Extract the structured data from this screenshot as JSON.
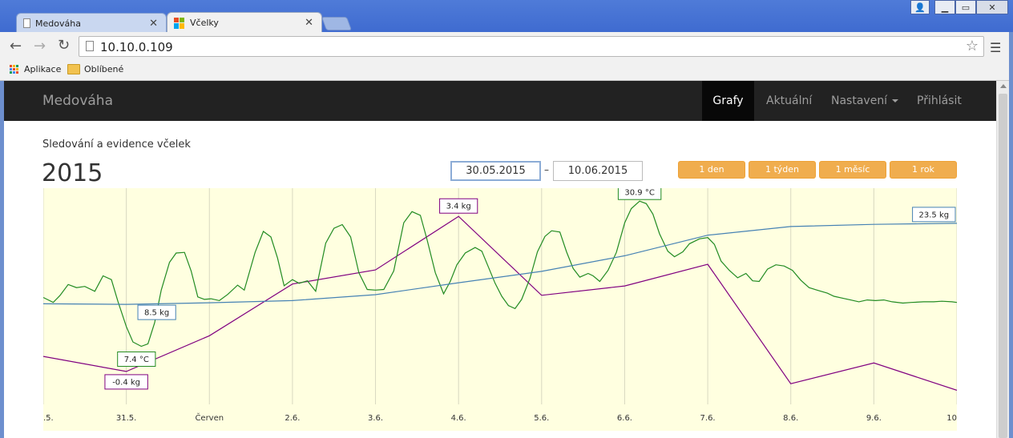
{
  "browser": {
    "tabs": [
      {
        "title": "Medováha",
        "active": false
      },
      {
        "title": "Včelky",
        "active": true
      }
    ],
    "url": "10.10.0.109",
    "bookmarks": [
      {
        "label": "Aplikace",
        "icon": "apps-grid-icon"
      },
      {
        "label": "Oblíbené",
        "icon": "folder-icon"
      }
    ]
  },
  "navbar": {
    "brand": "Medováha",
    "items": [
      {
        "label": "Grafy",
        "active": true
      },
      {
        "label": "Aktuální",
        "active": false
      },
      {
        "label": "Nastavení",
        "active": false,
        "dropdown": true
      },
      {
        "label": "Přihlásit",
        "active": false
      }
    ]
  },
  "header": {
    "subtitle": "Sledování a evidence včelek",
    "year": "2015"
  },
  "date_range": {
    "from": "30.05.2015",
    "separator": "–",
    "to": "10.06.2015"
  },
  "range_buttons": [
    "1 den",
    "1 týden",
    "1 měsíc",
    "1 rok"
  ],
  "colors": {
    "accent_orange": "#f0ad4e",
    "chart_bg": "#ffffe0",
    "purple_series": "#800080",
    "green_series": "#228b22",
    "blue_series": "#4682b4",
    "navbar_bg": "#222222"
  },
  "chart_data": {
    "type": "line",
    "x_tick_labels": [
      ".5.",
      "31.5.",
      "Červen",
      "2.6.",
      "3.6.",
      "4.6.",
      "5.6.",
      "6.6.",
      "7.6.",
      "8.6.",
      "9.6.",
      "10"
    ],
    "xlim": [
      0,
      11
    ],
    "grid": true,
    "series": [
      {
        "color": "#800080",
        "points": [
          [
            0,
            36
          ],
          [
            1,
            20
          ],
          [
            2,
            58
          ],
          [
            3,
            113
          ],
          [
            4,
            128
          ],
          [
            5,
            185
          ],
          [
            6,
            101
          ],
          [
            7,
            111
          ],
          [
            8,
            134
          ],
          [
            9,
            7
          ],
          [
            10,
            29
          ],
          [
            11,
            0
          ]
        ]
      },
      {
        "color": "#228b22",
        "points": [
          [
            0,
            15.3
          ],
          [
            0.12,
            14.5
          ],
          [
            0.2,
            15.6
          ],
          [
            0.3,
            17.4
          ],
          [
            0.4,
            16.9
          ],
          [
            0.5,
            17.1
          ],
          [
            0.62,
            16.3
          ],
          [
            0.72,
            18.8
          ],
          [
            0.82,
            18.2
          ],
          [
            0.9,
            14.6
          ],
          [
            1,
            10.6
          ],
          [
            1.08,
            8.1
          ],
          [
            1.18,
            7.4
          ],
          [
            1.26,
            7.8
          ],
          [
            1.34,
            11.2
          ],
          [
            1.42,
            16.5
          ],
          [
            1.52,
            21.0
          ],
          [
            1.6,
            22.5
          ],
          [
            1.7,
            22.6
          ],
          [
            1.78,
            19.6
          ],
          [
            1.86,
            15.4
          ],
          [
            1.94,
            15.0
          ],
          [
            2.02,
            15.1
          ],
          [
            2.12,
            14.8
          ],
          [
            2.22,
            15.8
          ],
          [
            2.34,
            17.3
          ],
          [
            2.42,
            16.5
          ],
          [
            2.55,
            22.6
          ],
          [
            2.65,
            26.0
          ],
          [
            2.74,
            25.1
          ],
          [
            2.82,
            21.7
          ],
          [
            2.9,
            17.2
          ],
          [
            3,
            18.2
          ],
          [
            3.08,
            17.6
          ],
          [
            3.18,
            18.0
          ],
          [
            3.28,
            16.3
          ],
          [
            3.4,
            24.1
          ],
          [
            3.5,
            26.5
          ],
          [
            3.6,
            27.1
          ],
          [
            3.7,
            25.1
          ],
          [
            3.8,
            19.3
          ],
          [
            3.9,
            16.6
          ],
          [
            4.0,
            16.5
          ],
          [
            4.1,
            16.6
          ],
          [
            4.22,
            19.6
          ],
          [
            4.34,
            27.4
          ],
          [
            4.44,
            29.2
          ],
          [
            4.54,
            28.6
          ],
          [
            4.62,
            24.7
          ],
          [
            4.72,
            19.3
          ],
          [
            4.82,
            15.9
          ],
          [
            4.9,
            17.9
          ],
          [
            4.98,
            20.6
          ],
          [
            5.08,
            22.5
          ],
          [
            5.2,
            23.4
          ],
          [
            5.28,
            22.8
          ],
          [
            5.36,
            20.2
          ],
          [
            5.44,
            17.6
          ],
          [
            5.52,
            15.5
          ],
          [
            5.6,
            14.0
          ],
          [
            5.68,
            13.5
          ],
          [
            5.76,
            15.0
          ],
          [
            5.86,
            18.4
          ],
          [
            5.95,
            22.7
          ],
          [
            6.04,
            25.2
          ],
          [
            6.12,
            26.1
          ],
          [
            6.22,
            25.9
          ],
          [
            6.3,
            22.7
          ],
          [
            6.38,
            20.0
          ],
          [
            6.46,
            18.6
          ],
          [
            6.56,
            19.2
          ],
          [
            6.62,
            18.8
          ],
          [
            6.7,
            17.9
          ],
          [
            6.8,
            19.7
          ],
          [
            6.9,
            22.6
          ],
          [
            7.0,
            27.4
          ],
          [
            7.08,
            29.7
          ],
          [
            7.18,
            30.9
          ],
          [
            7.26,
            30.5
          ],
          [
            7.34,
            28.8
          ],
          [
            7.42,
            25.6
          ],
          [
            7.52,
            22.8
          ],
          [
            7.6,
            21.9
          ],
          [
            7.7,
            22.7
          ],
          [
            7.78,
            24.0
          ],
          [
            7.9,
            24.8
          ],
          [
            8.0,
            25.0
          ],
          [
            8.08,
            23.9
          ],
          [
            8.16,
            21.2
          ],
          [
            8.26,
            19.7
          ],
          [
            8.36,
            18.5
          ],
          [
            8.46,
            19.2
          ],
          [
            8.54,
            18.0
          ],
          [
            8.62,
            17.9
          ],
          [
            8.72,
            19.9
          ],
          [
            8.82,
            20.6
          ],
          [
            8.92,
            20.4
          ],
          [
            9.02,
            19.7
          ],
          [
            9.12,
            18.1
          ],
          [
            9.22,
            16.9
          ],
          [
            9.34,
            16.4
          ],
          [
            9.44,
            16.0
          ],
          [
            9.52,
            15.5
          ],
          [
            9.62,
            15.2
          ],
          [
            9.72,
            14.9
          ],
          [
            9.82,
            14.6
          ],
          [
            9.92,
            14.9
          ],
          [
            10.02,
            14.8
          ],
          [
            10.12,
            14.9
          ],
          [
            10.22,
            14.6
          ],
          [
            10.35,
            14.4
          ],
          [
            10.45,
            14.5
          ],
          [
            10.6,
            14.6
          ],
          [
            10.72,
            14.6
          ],
          [
            10.82,
            14.7
          ],
          [
            10.94,
            14.6
          ],
          [
            11,
            14.5
          ]
        ]
      },
      {
        "color": "#4682b4",
        "points": [
          [
            0,
            8.6
          ],
          [
            1,
            8.5
          ],
          [
            2,
            8.8
          ],
          [
            3,
            9.2
          ],
          [
            4,
            10.3
          ],
          [
            5,
            12.5
          ],
          [
            6,
            14.6
          ],
          [
            7,
            17.5
          ],
          [
            8,
            21.3
          ],
          [
            9,
            22.9
          ],
          [
            10,
            23.3
          ],
          [
            11,
            23.5
          ]
        ]
      }
    ],
    "annotations": [
      {
        "text": "-0.4 kg",
        "series": 0,
        "x": 1
      },
      {
        "text": "3.4 kg",
        "series": 0,
        "x": 5
      },
      {
        "text": "30.9 °C",
        "series": 1,
        "x": 7.18
      },
      {
        "text": "7.4 °C",
        "series": 1,
        "x": 1.18
      },
      {
        "text": "8.5 kg",
        "series": 2,
        "x": 1
      },
      {
        "text": "23.5 kg",
        "series": 2,
        "x": 11
      }
    ]
  }
}
